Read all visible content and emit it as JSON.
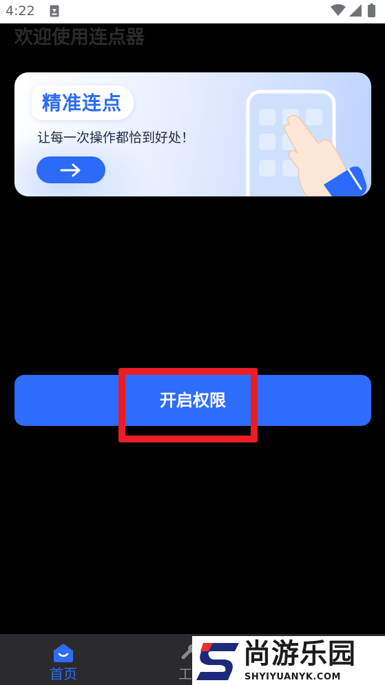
{
  "status_bar": {
    "time": "4:22",
    "icons": [
      "notification-icon",
      "wifi-icon",
      "signal-icon",
      "battery-icon"
    ]
  },
  "page": {
    "title": "欢迎使用连点器"
  },
  "banner": {
    "heading": "精准连点",
    "subtitle": "让每一次操作都恰到好处！",
    "arrow_icon": "arrow-right-icon"
  },
  "actions": {
    "open_permission_label": "开启权限"
  },
  "bottom_nav": {
    "items": [
      {
        "label": "首页",
        "icon": "home-icon",
        "active": true
      },
      {
        "label": "工",
        "icon": "tools-icon",
        "active": false
      }
    ]
  },
  "watermark": {
    "name": "尚游乐园",
    "url": "SHYIYUANYK.COM"
  },
  "colors": {
    "accent": "#2E6CFB",
    "highlight": "#EC1C24",
    "background": "#000000",
    "nav_background": "#2B2B2E"
  }
}
